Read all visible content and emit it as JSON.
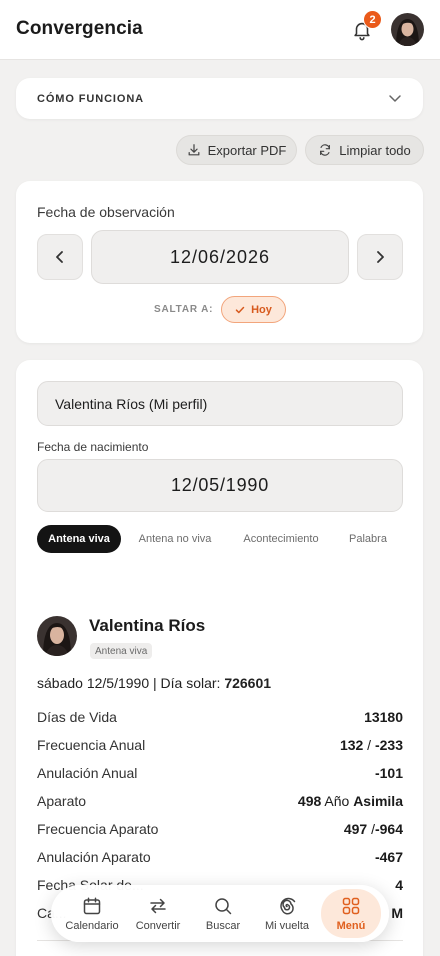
{
  "header": {
    "title": "Convergencia",
    "notifications_count": "2"
  },
  "how_it_works": {
    "label": "CÓMO FUNCIONA"
  },
  "actions": {
    "export_pdf": "Exportar PDF",
    "clear_all": "Limpiar todo"
  },
  "observation": {
    "label": "Fecha de observación",
    "date": "12/06/2026",
    "jump_label": "SALTAR A:",
    "today_label": "Hoy"
  },
  "profile": {
    "selected": "Valentina Ríos (Mi perfil)",
    "birth_label": "Fecha de nacimiento",
    "birth_date": "12/05/1990",
    "tabs": [
      "Antena viva",
      "Antena no viva",
      "Acontecimiento",
      "Palabra"
    ],
    "active_tab": "Antena viva"
  },
  "result": {
    "name": "Valentina Ríos",
    "tag": "Antena viva",
    "dob_text": "sábado 12/5/1990 | Día solar:",
    "solar_day": "726601",
    "rows": [
      {
        "label": "Días de Vida",
        "value": "13180"
      },
      {
        "label": "Frecuencia Anual",
        "value": "132 / -233",
        "v1": "132",
        "sep": " / ",
        "v2": "-233"
      },
      {
        "label": "Anulación Anual",
        "value": "-101"
      },
      {
        "label": "Aparato",
        "value": "498 Año Asimila",
        "v1": "498",
        "sep": " Año ",
        "v2": "Asimila"
      },
      {
        "label": "Frecuencia Aparato",
        "value": "497 /-964",
        "v1": "497",
        "sep": " /",
        "v2": "-964"
      },
      {
        "label": "Anulación Aparato",
        "value": "-467"
      },
      {
        "label": "Fecha Solar de...",
        "value": "4"
      },
      {
        "label": "Ca...",
        "value": "M"
      }
    ]
  },
  "bottom_nav": {
    "items": [
      "Calendario",
      "Convertir",
      "Buscar",
      "Mi vuelta",
      "Menú"
    ],
    "active": "Menú",
    "accent": "#E0601F"
  },
  "colors": {
    "accent": "#EA5A1A",
    "background": "#F2F1F0",
    "card": "#FFFFFF"
  }
}
